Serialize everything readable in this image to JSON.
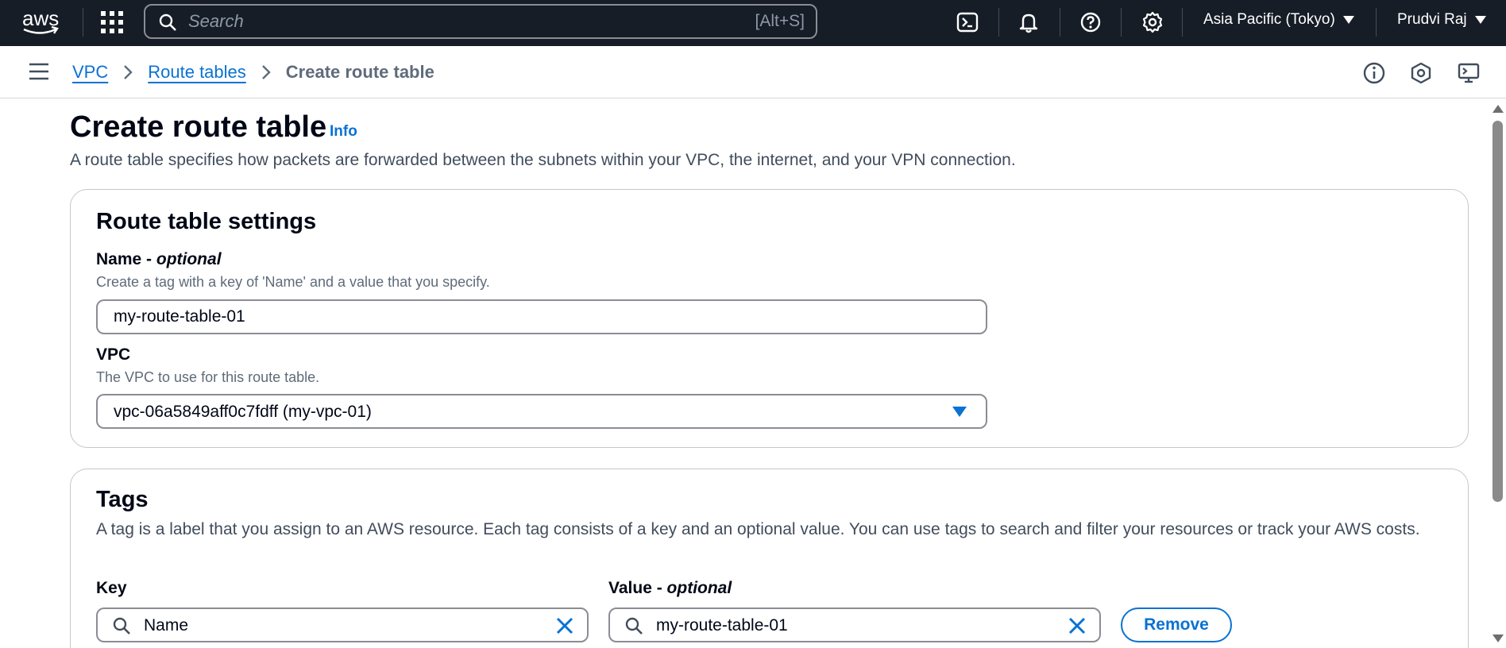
{
  "topnav": {
    "logo_text": "aws",
    "search_placeholder": "Search",
    "search_shortcut": "[Alt+S]",
    "region": "Asia Pacific (Tokyo)",
    "user": "Prudvi Raj"
  },
  "breadcrumb": {
    "items": [
      "VPC",
      "Route tables"
    ],
    "current": "Create route table"
  },
  "page": {
    "title": "Create route table",
    "info_link": "Info",
    "description": "A route table specifies how packets are forwarded between the subnets within your VPC, the internet, and your VPN connection."
  },
  "settings": {
    "heading": "Route table settings",
    "name_label": "Name -",
    "name_optional": "optional",
    "name_hint": "Create a tag with a key of 'Name' and a value that you specify.",
    "name_value": "my-route-table-01",
    "vpc_label": "VPC",
    "vpc_hint": "The VPC to use for this route table.",
    "vpc_value": "vpc-06a5849aff0c7fdff (my-vpc-01)"
  },
  "tags": {
    "heading": "Tags",
    "description": "A tag is a label that you assign to an AWS resource. Each tag consists of a key and an optional value. You can use tags to search and filter your resources or track your AWS costs.",
    "key_label": "Key",
    "value_label": "Value -",
    "value_optional": "optional",
    "rows": [
      {
        "key": "Name",
        "value": "my-route-table-01"
      }
    ],
    "remove_label": "Remove"
  },
  "colors": {
    "nav_bg": "#161d26",
    "link": "#0972d3",
    "text": "#000716",
    "muted": "#5f6b7a",
    "border": "#8c8c94"
  }
}
